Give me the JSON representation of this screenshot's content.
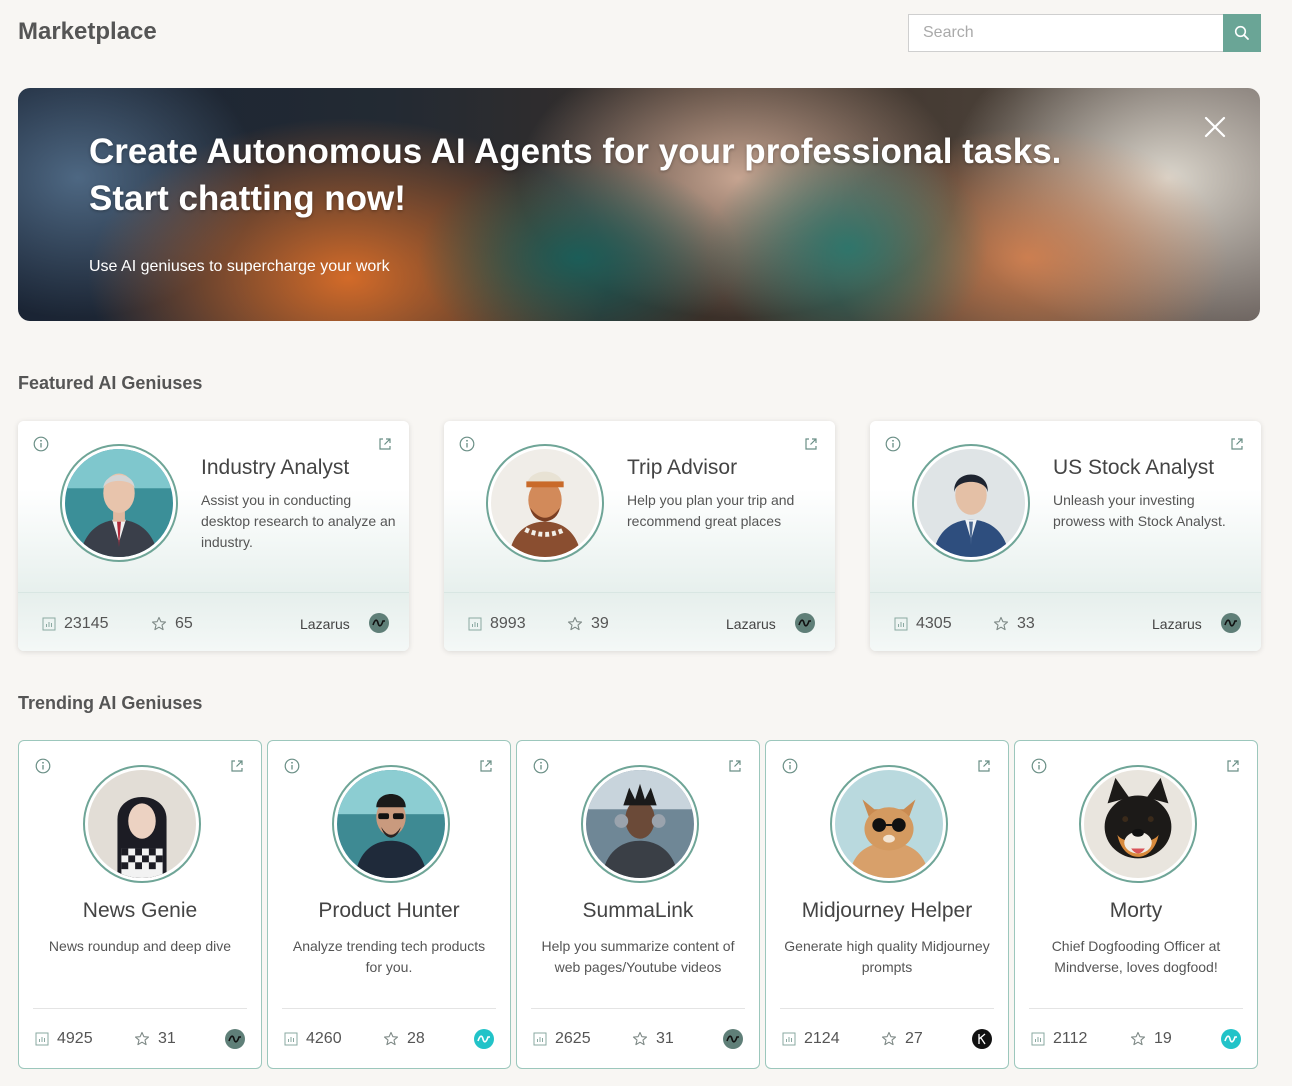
{
  "header": {
    "title": "Marketplace",
    "search_placeholder": "Search"
  },
  "banner": {
    "headline_line1": "Create Autonomous AI Agents for your professional tasks.",
    "headline_line2": "Start chatting now!",
    "subtitle": "Use AI geniuses to supercharge your work"
  },
  "featured": {
    "title": "Featured AI Geniuses",
    "cards": [
      {
        "name": "Industry Analyst",
        "description": "Assist you in conducting desktop research to analyze an industry.",
        "uses": "23145",
        "stars": "65",
        "author": "Lazarus"
      },
      {
        "name": "Trip Advisor",
        "description": "Help you plan your trip and recommend great places",
        "uses": "8993",
        "stars": "39",
        "author": "Lazarus"
      },
      {
        "name": "US Stock Analyst",
        "description": "Unleash your investing prowess with Stock Analyst.",
        "uses": "4305",
        "stars": "33",
        "author": "Lazarus"
      }
    ]
  },
  "trending": {
    "title": "Trending AI Geniuses",
    "cards": [
      {
        "name": "News Genie",
        "description": "News roundup and deep dive",
        "uses": "4925",
        "stars": "31"
      },
      {
        "name": "Product Hunter",
        "description": "Analyze trending tech products for you.",
        "uses": "4260",
        "stars": "28"
      },
      {
        "name": "SummaLink",
        "description": "Help you summarize content of web pages/Youtube videos",
        "uses": "2625",
        "stars": "31"
      },
      {
        "name": "Midjourney Helper",
        "description": "Generate high quality Midjourney prompts",
        "uses": "2124",
        "stars": "27"
      },
      {
        "name": "Morty",
        "description": "Chief Dogfooding Officer at Mindverse, loves dogfood!",
        "uses": "2112",
        "stars": "19"
      }
    ]
  },
  "colors": {
    "accent": "#6aa596",
    "card_border": "#9cc7bc",
    "badge_gray": "#5f7f78",
    "badge_cyan": "#22c3c8",
    "badge_black": "#111111"
  },
  "icons": [
    "search-icon",
    "close-icon",
    "info-icon",
    "external-link-icon",
    "chart-icon",
    "star-icon",
    "creator-badge-icon"
  ]
}
